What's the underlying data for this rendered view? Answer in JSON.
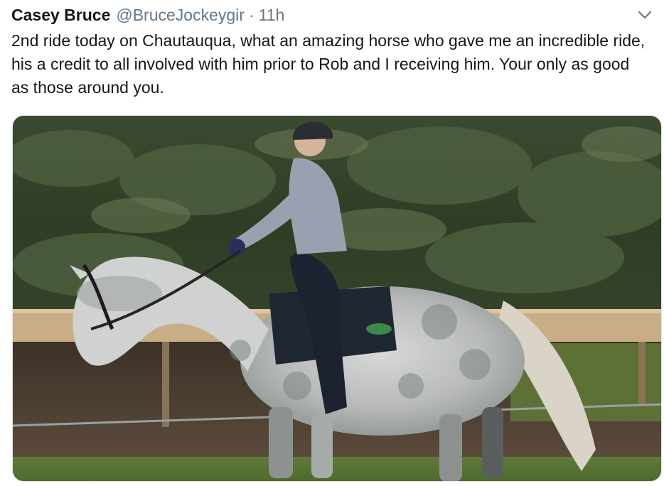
{
  "tweet": {
    "author_name": "Casey Bruce",
    "author_handle": "@BruceJockeygir",
    "separator": "·",
    "timestamp": "11h",
    "text": "2nd ride today on Chautauqua, what an amazing horse who gave me an incredible ride, his a credit to all involved with him prior to Rob and I receiving him. Your only as good as those around you.",
    "menu_icon": "chevron-down-icon",
    "media": {
      "type": "photo"
    }
  },
  "colors": {
    "text": "#14171a",
    "secondary_text": "#657786",
    "border": "#e1e8ed"
  }
}
